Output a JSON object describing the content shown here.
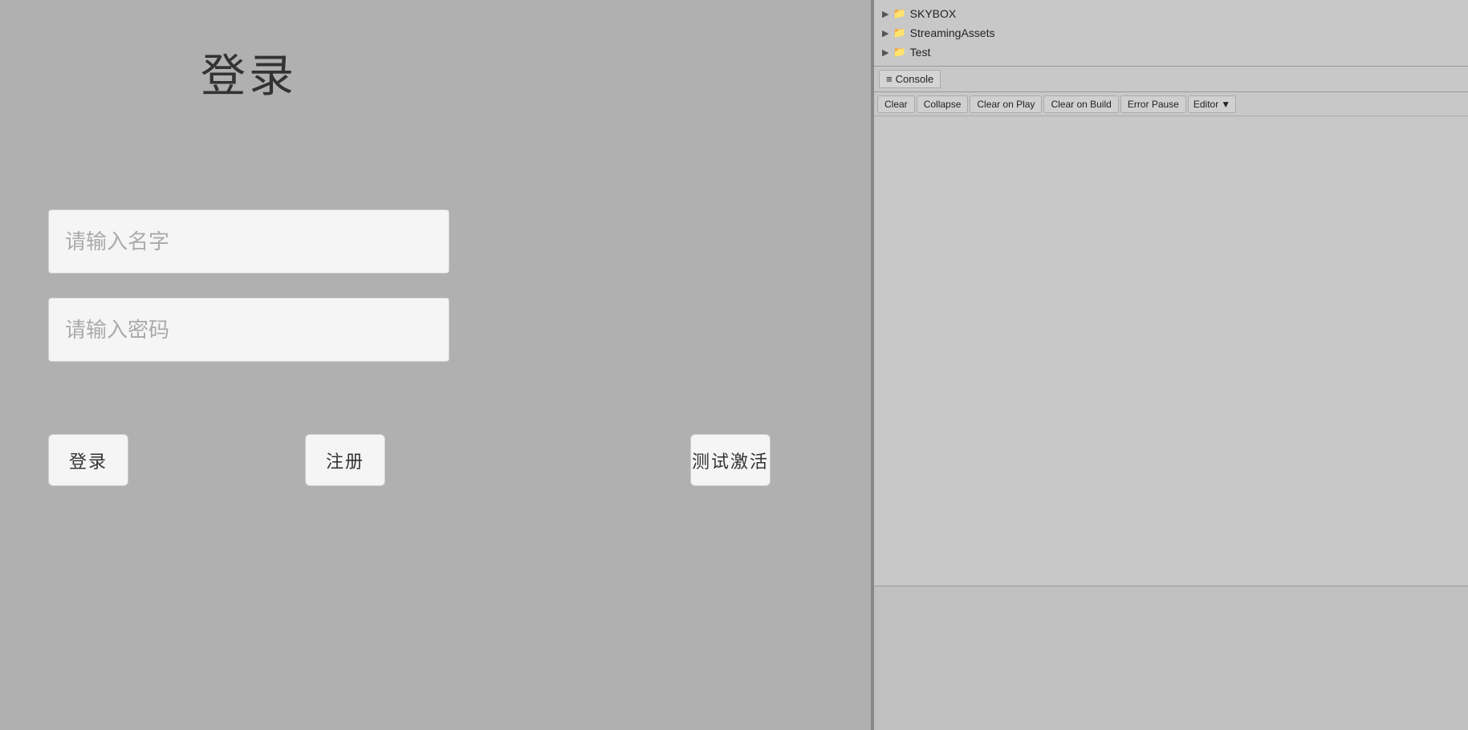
{
  "login": {
    "title": "登录",
    "username_placeholder": "请输入名字",
    "password_placeholder": "请输入密码",
    "login_btn": "登录",
    "register_btn": "注册",
    "test_btn": "测试激活"
  },
  "file_tree": {
    "items": [
      {
        "label": "SKYBOX",
        "type": "folder"
      },
      {
        "label": "StreamingAssets",
        "type": "folder"
      },
      {
        "label": "Test",
        "type": "folder"
      }
    ]
  },
  "console": {
    "tab_label": "Console",
    "tab_icon": "≡",
    "toolbar": {
      "clear": "Clear",
      "collapse": "Collapse",
      "clear_on_play": "Clear on Play",
      "clear_on_build": "Clear on Build",
      "error_pause": "Error Pause",
      "editor": "Editor",
      "editor_dropdown_arrow": "▼"
    }
  }
}
